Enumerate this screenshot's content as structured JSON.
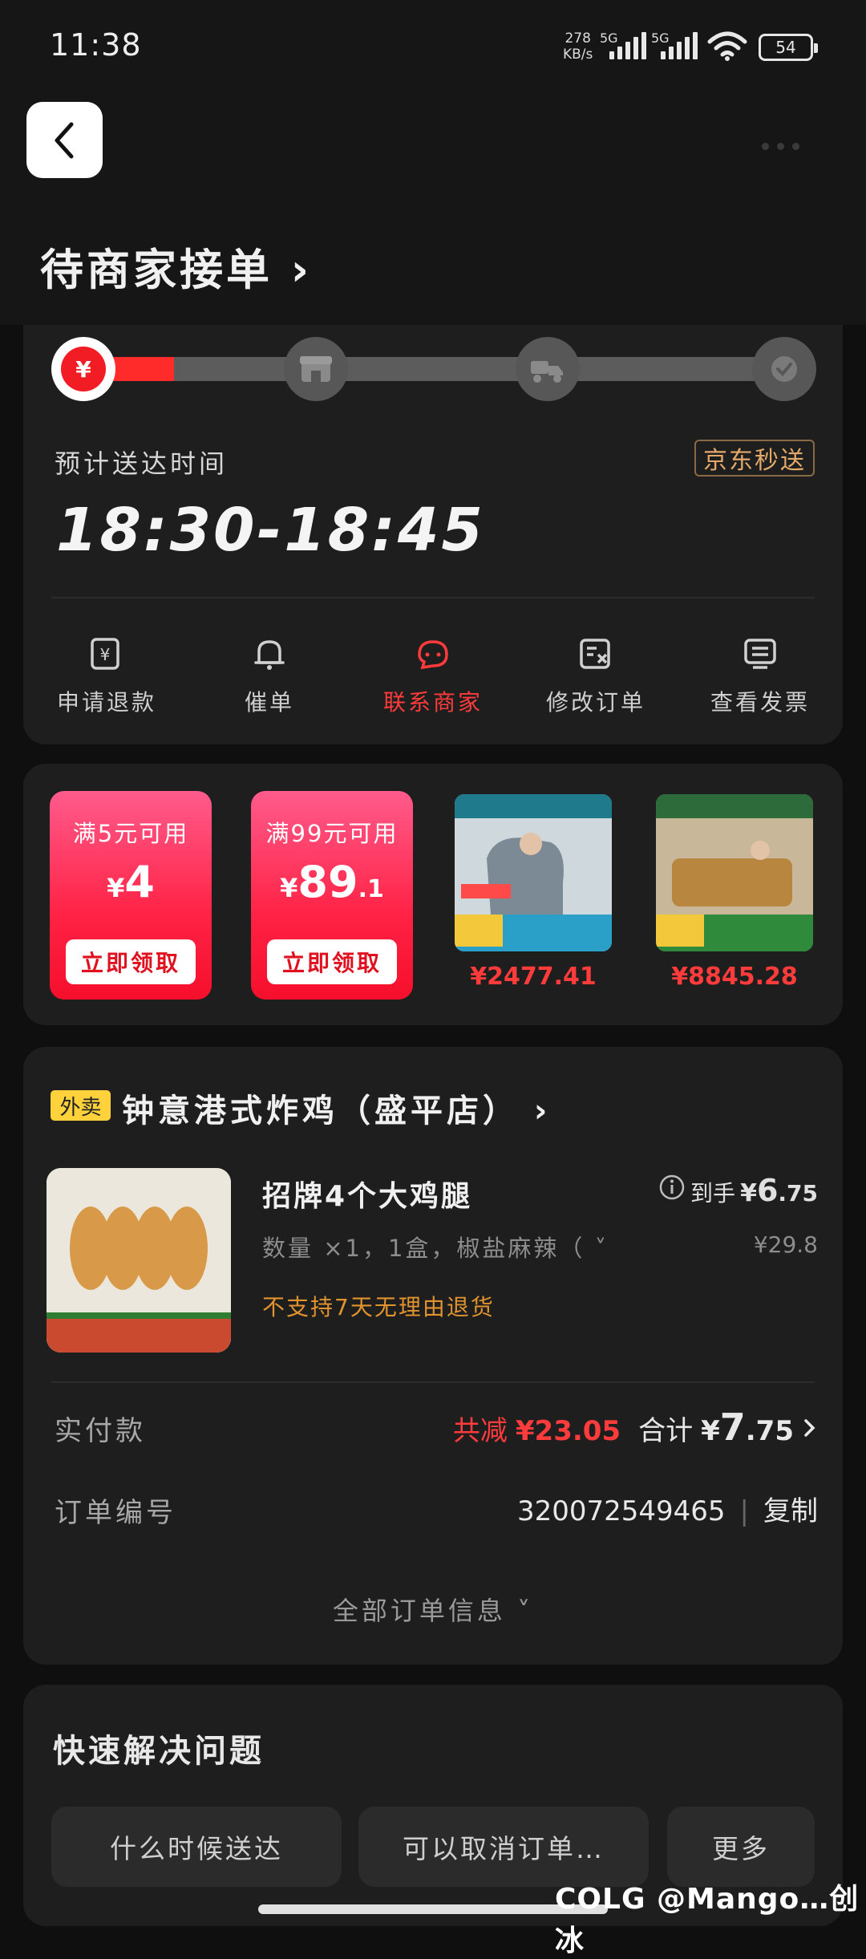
{
  "status_bar": {
    "time": "11:38",
    "net_speed_top": "278",
    "net_speed_unit": "KB/s",
    "net_1": "5G",
    "net_2": "5G",
    "battery": "54"
  },
  "header": {
    "order_status": "待商家接单 ›"
  },
  "progress": {
    "fraction": 0.13,
    "steps": [
      "payment-icon",
      "store-icon",
      "delivery-icon",
      "check-icon"
    ],
    "active_symbol": "¥"
  },
  "delivery": {
    "eta_label": "预计送达时间",
    "eta_time": "18:30-18:45",
    "service_badge": "京东秒送"
  },
  "actions": [
    {
      "label": "申请退款",
      "icon": "refund-icon"
    },
    {
      "label": "催单",
      "icon": "bell-icon"
    },
    {
      "label": "联系商家",
      "icon": "chat-icon"
    },
    {
      "label": "修改订单",
      "icon": "edit-order-icon"
    },
    {
      "label": "查看发票",
      "icon": "invoice-icon"
    }
  ],
  "promos": {
    "coupons": [
      {
        "condition": "满5元可用",
        "yen": "¥",
        "amount": "4",
        "decimal": "",
        "claim": "立即领取"
      },
      {
        "condition": "满99元可用",
        "yen": "¥",
        "amount": "89",
        "decimal": ".1",
        "claim": "立即领取"
      }
    ],
    "products": [
      {
        "price": "¥2477.41"
      },
      {
        "price": "¥8845.28"
      }
    ]
  },
  "order": {
    "tag": "外卖",
    "shop_name": "钟意港式炸鸡（盛平店） ›",
    "item": {
      "name": "招牌4个大鸡腿",
      "spec": "数量 ×1，1盒，椒盐麻辣（ ˅",
      "note": "不支持7天无理由退货",
      "net_label": "到手",
      "net_yen": "¥",
      "net_int": "6",
      "net_dec": ".75",
      "original_price": "¥29.8"
    },
    "paid_label": "实付款",
    "discount_label": "共减",
    "discount": "¥23.05",
    "total_label": "合计",
    "total_yen": "¥",
    "total_int": "7",
    "total_dec": ".75",
    "order_no_label": "订单编号",
    "order_no": "320072549465",
    "copy_label": "复制",
    "all_info": "全部订单信息 ˅"
  },
  "quick": {
    "title": "快速解决问题",
    "buttons": [
      "什么时候送达",
      "可以取消订单…",
      "更多"
    ]
  },
  "watermark": "COLG @Mango…创冰",
  "colors": {
    "accent_red": "#ff3b3b",
    "background": "#0f0f0f",
    "card": "#1e1e1e"
  }
}
